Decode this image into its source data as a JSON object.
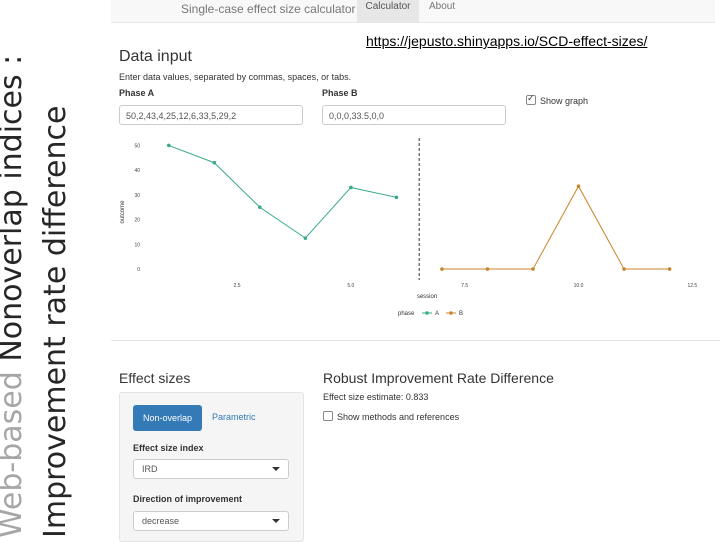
{
  "slide": {
    "title_light": "Web-based ",
    "title_dark": "Nonoverlap indices :",
    "title_line2": "Improvement rate difference"
  },
  "navbar": {
    "brand": "Single-case effect size calculator",
    "tabs": [
      "Calculator",
      "About"
    ]
  },
  "url": "https://jepusto.shinyapps.io/SCD-effect-sizes/",
  "data_input": {
    "heading": "Data input",
    "instructions": "Enter data values, separated by commas, spaces, or tabs.",
    "phase_a_label": "Phase A",
    "phase_a_value": "50,2,43,4,25,12,6,33,5,29,2",
    "phase_b_label": "Phase B",
    "phase_b_value": "0,0,0,33.5,0,0",
    "show_graph_label": "Show graph",
    "show_graph_checked": true
  },
  "chart_data": {
    "type": "line",
    "xlabel": "session",
    "ylabel": "outcome",
    "x_ticks": [
      "2.5",
      "5.0",
      "7.5",
      "10.0",
      "12.5"
    ],
    "y_ticks": [
      "0",
      "10",
      "20",
      "30",
      "40",
      "50"
    ],
    "xlim": [
      0.5,
      12.8
    ],
    "ylim": [
      -2,
      53
    ],
    "phase_change_x": 6.5,
    "legend_title": "phase",
    "series": [
      {
        "name": "A",
        "color": "#3aaa8c",
        "x": [
          1,
          2,
          3,
          4,
          5,
          6
        ],
        "y": [
          50,
          43,
          25,
          12.5,
          33,
          29
        ]
      },
      {
        "name": "B",
        "color": "#c8842c",
        "x": [
          7,
          8,
          9,
          10,
          11,
          12
        ],
        "y": [
          0,
          0,
          0,
          33.5,
          0,
          0
        ]
      }
    ]
  },
  "effect_sizes": {
    "heading": "Effect sizes",
    "tab_active": "Non-overlap",
    "tab_other": "Parametric",
    "index_label": "Effect size index",
    "index_value": "IRD",
    "direction_label": "Direction of improvement",
    "direction_value": "decrease"
  },
  "result": {
    "heading": "Robust Improvement Rate Difference",
    "estimate": "Effect size estimate: 0.833",
    "show_methods_label": "Show methods and references"
  },
  "colors": {
    "primary": "#337ab7",
    "series_a": "#3aaa8c",
    "series_b": "#c8842c"
  }
}
